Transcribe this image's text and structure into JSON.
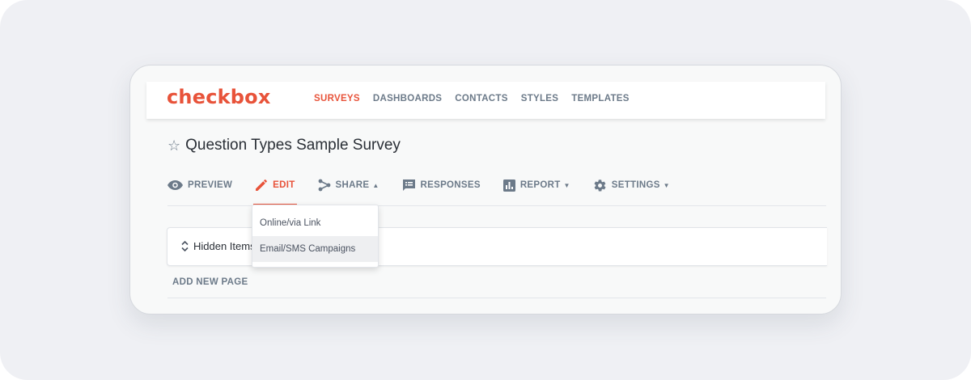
{
  "app": {
    "logo": "checkbox"
  },
  "top_nav": [
    {
      "label": "SURVEYS",
      "active": true
    },
    {
      "label": "DASHBOARDS",
      "active": false
    },
    {
      "label": "CONTACTS",
      "active": false
    },
    {
      "label": "STYLES",
      "active": false
    },
    {
      "label": "TEMPLATES",
      "active": false
    }
  ],
  "survey": {
    "title": "Question Types Sample Survey",
    "star_icon": "star-outline-icon"
  },
  "sub_nav": [
    {
      "label": "PREVIEW",
      "icon": "eye-icon"
    },
    {
      "label": "EDIT",
      "icon": "pencil-icon",
      "active": true
    },
    {
      "label": "SHARE",
      "icon": "share-icon",
      "caret": "▲"
    },
    {
      "label": "RESPONSES",
      "icon": "responses-icon"
    },
    {
      "label": "REPORT",
      "icon": "bar-chart-icon",
      "caret": "▼"
    },
    {
      "label": "SETTINGS",
      "icon": "gear-icon",
      "caret": "▼"
    }
  ],
  "share_menu": {
    "items": [
      "Online/via Link",
      "Email/SMS Campaigns"
    ],
    "highlighted": "Email/SMS Campaigns"
  },
  "content": {
    "hidden_items_label": "Hidden Items",
    "add_page_label": "ADD NEW PAGE"
  },
  "colors": {
    "accent": "#e8533a",
    "muted": "#6c7a89",
    "text": "#2a2f36",
    "background": "#eff0f4"
  }
}
